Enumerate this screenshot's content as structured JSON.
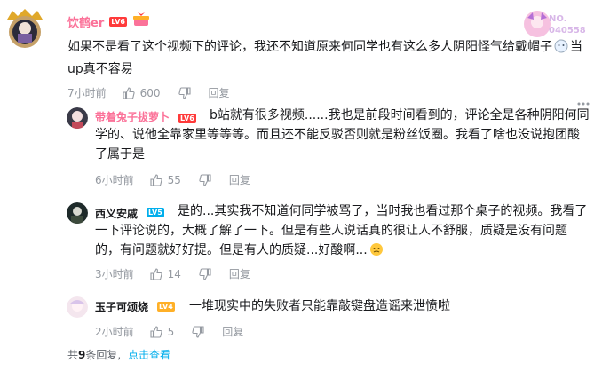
{
  "main_comment": {
    "username": "饮鹤er",
    "level": "LV6",
    "text": "如果不是看了这个视频下的评论，我还不知道原来何同学也有这么多人阴阳怪气给戴帽子",
    "text_line2": "up真不容易",
    "time": "7小时前",
    "likes": "600",
    "reply_label": "回复",
    "badge_text": "NO.",
    "badge_number": "040558"
  },
  "replies": [
    {
      "username": "带着兔子拔萝卜",
      "level": "LV6",
      "lines": [
        "b站就有很多视频......我也是前段时间看到的，评论全是各种阴阳何同",
        "学的、说他全靠家里等等等。而且还不能反驳否则就是粉丝饭圈。我看了啥也没说抱团酸",
        "了属于是"
      ],
      "time": "6小时前",
      "likes": "55",
      "reply_label": "回复"
    },
    {
      "username": "西义安戚",
      "level": "LV5",
      "lines": [
        "是的...其实我不知道何同学被骂了，当时我也看过那个桌子的视频。我看了",
        "一下评论说的，大概了解了一下。但是有些人说话真的很让人不舒服，质疑是没有问题",
        "的，有问题就好好提。但是有人的质疑...好酸啊..."
      ],
      "time": "3小时前",
      "likes": "14",
      "reply_label": "回复"
    },
    {
      "username": "玉子可颂烧",
      "level": "LV4",
      "lines": [
        "一堆现实中的失败者只能靠敲键盘造谣来泄愤啦"
      ],
      "time": "2小时前",
      "likes": "5",
      "reply_label": "回复"
    }
  ],
  "footer": {
    "prefix": "共",
    "count": "9",
    "suffix": "条回复,",
    "expand": "点击查看"
  },
  "colors": {
    "username": "#fb7299",
    "lv6": "#ff3a3a",
    "lv5": "#00aeec",
    "lv4": "#ffb027",
    "meta": "#9499a0",
    "link": "#00aeec"
  }
}
